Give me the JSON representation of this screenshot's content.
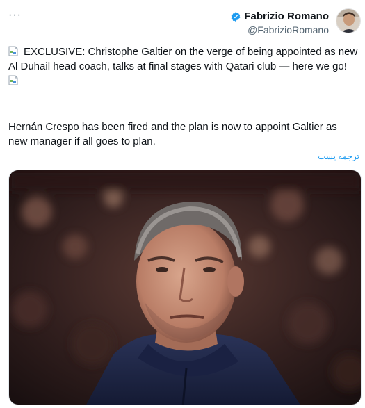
{
  "header": {
    "more_label": "···",
    "display_name": "Fabrizio Romano",
    "handle": "@FabrizioRomano",
    "verified_color": "#1d9bf0"
  },
  "tweet": {
    "line1": "EXCLUSIVE: Christophe Galtier on the verge of being appointed as new",
    "line2": "Al Duhail head coach, talks at final stages with Qatari club — here we go!",
    "paragraph2": "Hernán Crespo has been fired and the plan is now to appoint Galtier as new manager if all goes to plan.",
    "translate_label": "ترجمه پست"
  },
  "colors": {
    "link": "#1d9bf0",
    "jacket": "#1e2645",
    "background_crowd": "#2a1a1c"
  }
}
